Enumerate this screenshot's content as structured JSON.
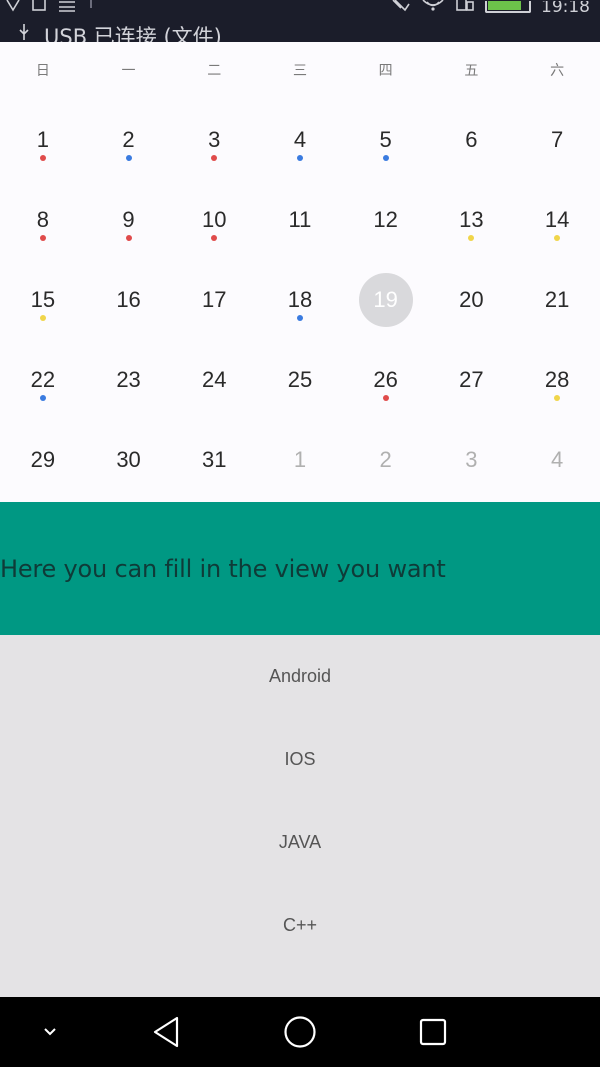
{
  "status_bar": {
    "notification_text": "USB 已连接 (文件)",
    "time": "19:18",
    "icons": [
      "vpn-icon",
      "image-icon",
      "message-icon",
      "usb-icon",
      "mute-icon",
      "wifi-icon",
      "sim-icon",
      "battery-icon"
    ]
  },
  "calendar": {
    "weekdays": [
      "日",
      "一",
      "二",
      "三",
      "四",
      "五",
      "六"
    ],
    "weeks": [
      [
        {
          "day": "1",
          "dot": "red"
        },
        {
          "day": "2",
          "dot": "blue"
        },
        {
          "day": "3",
          "dot": "red"
        },
        {
          "day": "4",
          "dot": "blue"
        },
        {
          "day": "5",
          "dot": "blue"
        },
        {
          "day": "6",
          "dot": ""
        },
        {
          "day": "7",
          "dot": ""
        }
      ],
      [
        {
          "day": "8",
          "dot": "red"
        },
        {
          "day": "9",
          "dot": "red"
        },
        {
          "day": "10",
          "dot": "red"
        },
        {
          "day": "11",
          "dot": ""
        },
        {
          "day": "12",
          "dot": ""
        },
        {
          "day": "13",
          "dot": "yellow"
        },
        {
          "day": "14",
          "dot": "yellow"
        }
      ],
      [
        {
          "day": "15",
          "dot": "yellow"
        },
        {
          "day": "16",
          "dot": ""
        },
        {
          "day": "17",
          "dot": ""
        },
        {
          "day": "18",
          "dot": "blue"
        },
        {
          "day": "19",
          "dot": "",
          "selected": true
        },
        {
          "day": "20",
          "dot": ""
        },
        {
          "day": "21",
          "dot": ""
        }
      ],
      [
        {
          "day": "22",
          "dot": "blue"
        },
        {
          "day": "23",
          "dot": ""
        },
        {
          "day": "24",
          "dot": ""
        },
        {
          "day": "25",
          "dot": ""
        },
        {
          "day": "26",
          "dot": "red"
        },
        {
          "day": "27",
          "dot": ""
        },
        {
          "day": "28",
          "dot": "yellow"
        }
      ],
      [
        {
          "day": "29",
          "dot": ""
        },
        {
          "day": "30",
          "dot": ""
        },
        {
          "day": "31",
          "dot": ""
        },
        {
          "day": "1",
          "dot": "",
          "other": true
        },
        {
          "day": "2",
          "dot": "",
          "other": true
        },
        {
          "day": "3",
          "dot": "",
          "other": true
        },
        {
          "day": "4",
          "dot": "",
          "other": true
        }
      ]
    ],
    "colors": {
      "red": "#e04b4b",
      "blue": "#3a7be0",
      "yellow": "#f0d54a",
      "selected": "#d9d9dc"
    }
  },
  "banner": {
    "text": "Here you can fill in the view you want",
    "color": "#009883"
  },
  "list": {
    "items": [
      "Android",
      "IOS",
      "JAVA",
      "C++"
    ]
  },
  "nav_bar": {
    "buttons": [
      "collapse-icon",
      "back-icon",
      "home-icon",
      "recents-icon"
    ]
  }
}
